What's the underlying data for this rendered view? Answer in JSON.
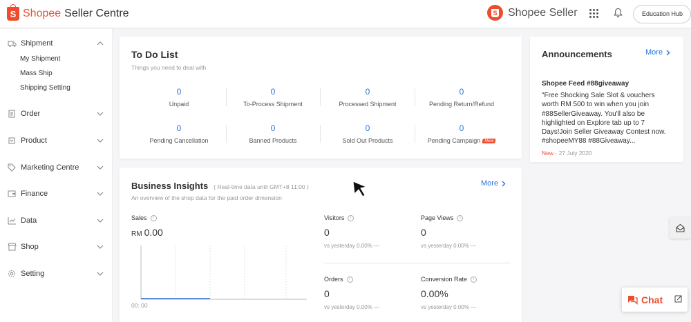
{
  "topbar": {
    "brand": "Shopee",
    "brand_suffix": "Seller Centre",
    "logo_letter": "S",
    "seller_logo_text": "Shopee Seller",
    "education_hub": "Education Hub"
  },
  "sidebar": {
    "sections": [
      {
        "label": "Shipment",
        "icon": "truck-icon",
        "expanded": true,
        "items": [
          "My Shipment",
          "Mass Ship",
          "Shipping Setting"
        ]
      },
      {
        "label": "Order",
        "icon": "clipboard-icon"
      },
      {
        "label": "Product",
        "icon": "box-icon"
      },
      {
        "label": "Marketing Centre",
        "icon": "tag-icon"
      },
      {
        "label": "Finance",
        "icon": "wallet-icon"
      },
      {
        "label": "Data",
        "icon": "chart-icon"
      },
      {
        "label": "Shop",
        "icon": "store-icon"
      },
      {
        "label": "Setting",
        "icon": "gear-icon"
      }
    ]
  },
  "todo": {
    "title": "To Do List",
    "subtitle": "Things you need to deal with",
    "items": [
      {
        "value": "0",
        "label": "Unpaid"
      },
      {
        "value": "0",
        "label": "To-Process Shipment"
      },
      {
        "value": "0",
        "label": "Processed Shipment"
      },
      {
        "value": "0",
        "label": "Pending Return/Refund"
      },
      {
        "value": "0",
        "label": "Pending Cancellation"
      },
      {
        "value": "0",
        "label": "Banned Products"
      },
      {
        "value": "0",
        "label": "Sold Out Products"
      },
      {
        "value": "0",
        "label": "Pending Campaign"
      }
    ],
    "new_badge": "New"
  },
  "announcements": {
    "title": "Announcements",
    "more": "More",
    "post_title": "Shopee Feed #88giveaway",
    "post_body": "\"Free Shocking Sale Slot & vouchers worth RM 500 to win when you join #88SellerGiveaway. You'll also be highlighted on Explore tab up to 7 Days!Join Seller Giveaway Contest now. #shopeeMY88 #88Giveaway...",
    "tag": "New",
    "date": "· 27 July 2020"
  },
  "insights": {
    "title": "Business Insights",
    "realtime": "( Real-time data until GMT+8 11:00 )",
    "subtitle": "An overview of the shop data for the paid order dimension",
    "more": "More",
    "sales_label": "Sales",
    "currency": "RM",
    "sales_value": "0.00",
    "x_tick": "00: 00",
    "metrics": [
      {
        "label": "Visitors",
        "value": "0",
        "compare": "vs yesterday 0.00% —"
      },
      {
        "label": "Page Views",
        "value": "0",
        "compare": "vs yesterday 0.00% —"
      },
      {
        "label": "Orders",
        "value": "0",
        "compare": "vs yesterday 0.00% —"
      },
      {
        "label": "Conversion Rate",
        "value": "0.00%",
        "compare": "vs yesterday 0.00% —"
      }
    ]
  },
  "chat": {
    "label": "Chat"
  },
  "colors": {
    "brand": "#ee4d2d",
    "link": "#2673dd"
  }
}
